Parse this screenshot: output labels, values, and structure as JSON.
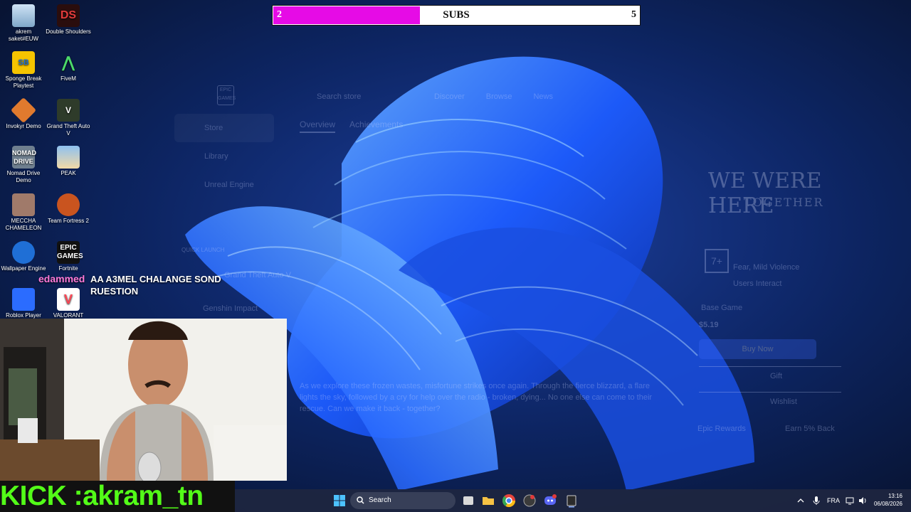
{
  "subs_goal": {
    "current": "2",
    "label": "SUBS",
    "target": "5",
    "progress": 0.4
  },
  "desktop_icons": [
    {
      "label": "akrem saket#EUW",
      "icon": "recycle-bin-icon"
    },
    {
      "label": "Double Shoulders",
      "icon": "double-shoulders-icon"
    },
    {
      "label": "Sponge Break Playtest",
      "icon": "sponge-break-icon"
    },
    {
      "label": "FiveM",
      "icon": "fivem-icon"
    },
    {
      "label": "Invokyr Demo",
      "icon": "invokyr-icon"
    },
    {
      "label": "Grand Theft Auto V",
      "icon": "gta-icon"
    },
    {
      "label": "Nomad Drive Demo",
      "icon": "nomad-drive-icon"
    },
    {
      "label": "PEAK",
      "icon": "peak-icon"
    },
    {
      "label": "MECCHA CHAMELEON",
      "icon": "chameleon-icon"
    },
    {
      "label": "Team Fortress 2",
      "icon": "tf2-icon"
    },
    {
      "label": "Wallpaper Engine",
      "icon": "wallpaper-engine-icon"
    },
    {
      "label": "Fortnite",
      "icon": "epic-games-icon"
    },
    {
      "label": "Roblox Player",
      "icon": "roblox-icon"
    },
    {
      "label": "VALORANT",
      "icon": "valorant-icon"
    }
  ],
  "chat": {
    "username": "edammed",
    "message": "AA A3MEL CHALANGE SOND RUESTION"
  },
  "kick_handle": "KICK :akram_tn",
  "launcher": {
    "nav": [
      "Discover",
      "Browse",
      "News"
    ],
    "search_placeholder": "Search store",
    "sidebar": [
      "Store",
      "Library",
      "Unreal Engine",
      ""
    ],
    "quick_launch": "QUICK LAUNCH",
    "quick_items": [
      "Grand Theft Auto V",
      "Genshin Impact"
    ],
    "tabs": [
      "Overview",
      "Achievements"
    ],
    "game_title": "WE WERE HERE",
    "game_subtitle": "TOGETHER",
    "rating": "7+",
    "rating_desc": "Fear, Mild Violence",
    "rating_note": "Users Interact",
    "base_game": "Base Game",
    "price": "$5.19",
    "buy": "Buy Now",
    "gift": "Gift",
    "wishlist": "Wishlist",
    "rewards": "Epic Rewards",
    "earn": "Earn 5% Back",
    "description": "As we explore these frozen wastes, misfortune strikes once again. Through the fierce blizzard, a flare lights the sky, followed by a cry for help over the radio - broken, dying... No one else can come to their rescue. Can we make it back - together?"
  },
  "taskbar": {
    "search_label": "Search",
    "language": "FRA",
    "time": "13:16",
    "date": "06/08/2026"
  }
}
